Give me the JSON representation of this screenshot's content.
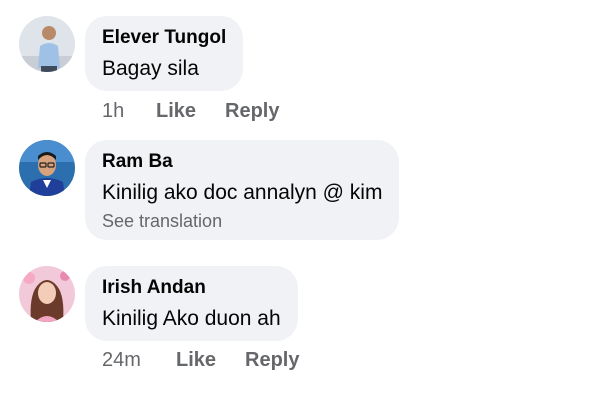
{
  "comments": [
    {
      "author": "Elever Tungol",
      "text": "Bagay sila",
      "time": "1h",
      "like_label": "Like",
      "reply_label": "Reply"
    },
    {
      "author": "Ram Ba",
      "text": "Kinilig ako doc annalyn @ kim",
      "see_translation": "See translation"
    },
    {
      "author": "Irish Andan",
      "text": "Kinilig Ako duon ah",
      "time": "24m",
      "like_label": "Like",
      "reply_label": "Reply"
    }
  ],
  "colors": {
    "bubble": "#f0f2f5",
    "secondary_text": "#65676b",
    "primary_text": "#050505"
  }
}
